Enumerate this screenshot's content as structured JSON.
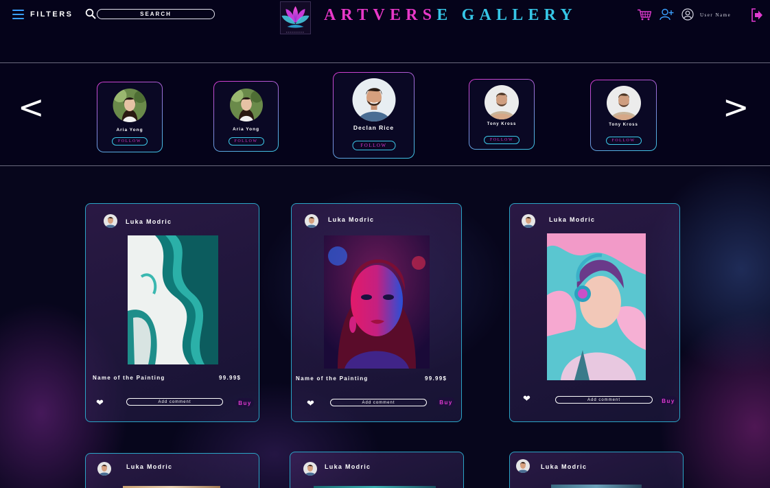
{
  "header": {
    "filters_label": "FILTERS",
    "search_placeholder": "SEARCH",
    "brand_part1": "ARTVERS",
    "brand_part2": "E GALLERY",
    "username": "User Name"
  },
  "artists": [
    {
      "name": "Aria Yong",
      "follow": "FOLLOW"
    },
    {
      "name": "Aria Yong",
      "follow": "FOLLOW"
    },
    {
      "name": "Declan Rice",
      "follow": "FOLLOW"
    },
    {
      "name": "Tony Kross",
      "follow": "FOLLOW"
    },
    {
      "name": "Tony Kross",
      "follow": "FOLLOW"
    }
  ],
  "nav": {
    "prev": "<",
    "next": ">"
  },
  "cards": [
    {
      "author": "Luka Modric",
      "painting_name": "Name of the Painting",
      "price": "99.99$",
      "comment": "Add comment",
      "buy": "Buy"
    },
    {
      "author": "Luka Modric",
      "painting_name": "Name of the Painting",
      "price": "99.99$",
      "comment": "Add comment",
      "buy": "Buy"
    },
    {
      "author": "Luka Modric",
      "comment": "Add comment",
      "buy": "Buy"
    },
    {
      "author": "Luka Modric"
    },
    {
      "author": "Luka Modric"
    },
    {
      "author": "Luka Modric"
    }
  ],
  "colors": {
    "accent_pink": "#e03ad0",
    "accent_cyan": "#36c6e6",
    "background": "#05031a"
  },
  "icons": [
    "menu-icon",
    "search-icon",
    "cart-icon",
    "add-user-icon",
    "user-icon",
    "logout-icon",
    "heart-icon"
  ]
}
